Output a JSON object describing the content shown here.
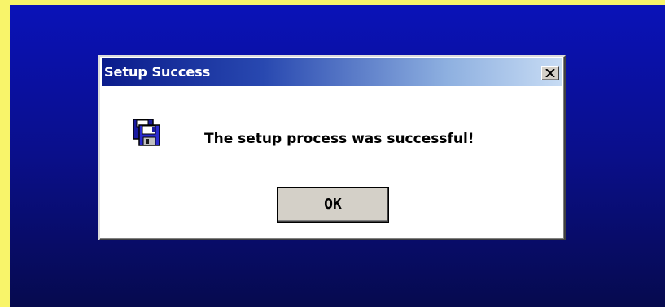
{
  "dialog": {
    "title": "Setup Success",
    "message": "The setup process was successful!",
    "ok_label": "OK"
  },
  "icons": {
    "dialog_icon": "floppy-disk-icon",
    "close": "close-icon"
  },
  "colors": {
    "desktop_top": "#0a12b8",
    "desktop_bottom": "#060a4e",
    "outer_border": "#f8f46a",
    "titlebar_start": "#0b1c8c",
    "titlebar_end": "#c8dcf4",
    "button_face": "#d4d0c8"
  }
}
